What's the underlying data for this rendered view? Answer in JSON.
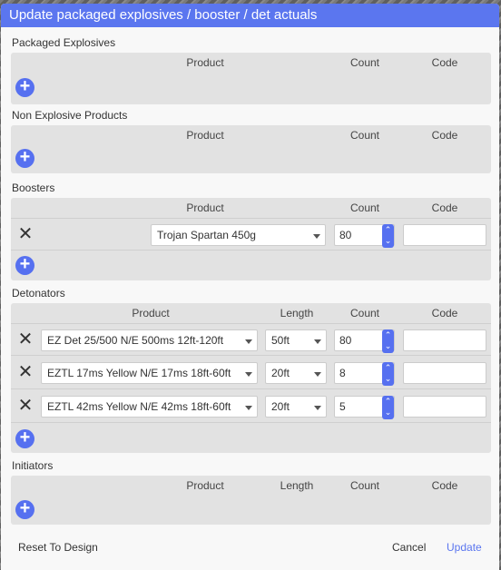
{
  "dialog": {
    "title": "Update packaged explosives / booster / det actuals",
    "accent_color": "#5b76ef"
  },
  "headers": {
    "product": "Product",
    "length": "Length",
    "count": "Count",
    "code": "Code"
  },
  "sections": {
    "packaged": {
      "label": "Packaged Explosives"
    },
    "non_explosive": {
      "label": "Non Explosive Products"
    },
    "boosters": {
      "label": "Boosters",
      "rows": [
        {
          "product": "Trojan Spartan 450g",
          "count": "80",
          "code": ""
        }
      ]
    },
    "detonators": {
      "label": "Detonators",
      "rows": [
        {
          "product": "EZ Det 25/500 N/E 500ms 12ft-120ft",
          "length": "50ft",
          "count": "80",
          "code": ""
        },
        {
          "product": "EZTL 17ms Yellow N/E 17ms 18ft-60ft",
          "length": "20ft",
          "count": "8",
          "code": ""
        },
        {
          "product": "EZTL 42ms Yellow N/E 42ms 18ft-60ft",
          "length": "20ft",
          "count": "5",
          "code": ""
        }
      ]
    },
    "initiators": {
      "label": "Initiators"
    }
  },
  "footer": {
    "reset_label": "Reset To Design",
    "cancel_label": "Cancel",
    "update_label": "Update"
  },
  "icons": {
    "add": "plus-circle-icon",
    "delete": "close-icon",
    "dropdown": "chevron-down-icon",
    "stepper": "stepper-arrows-icon"
  }
}
